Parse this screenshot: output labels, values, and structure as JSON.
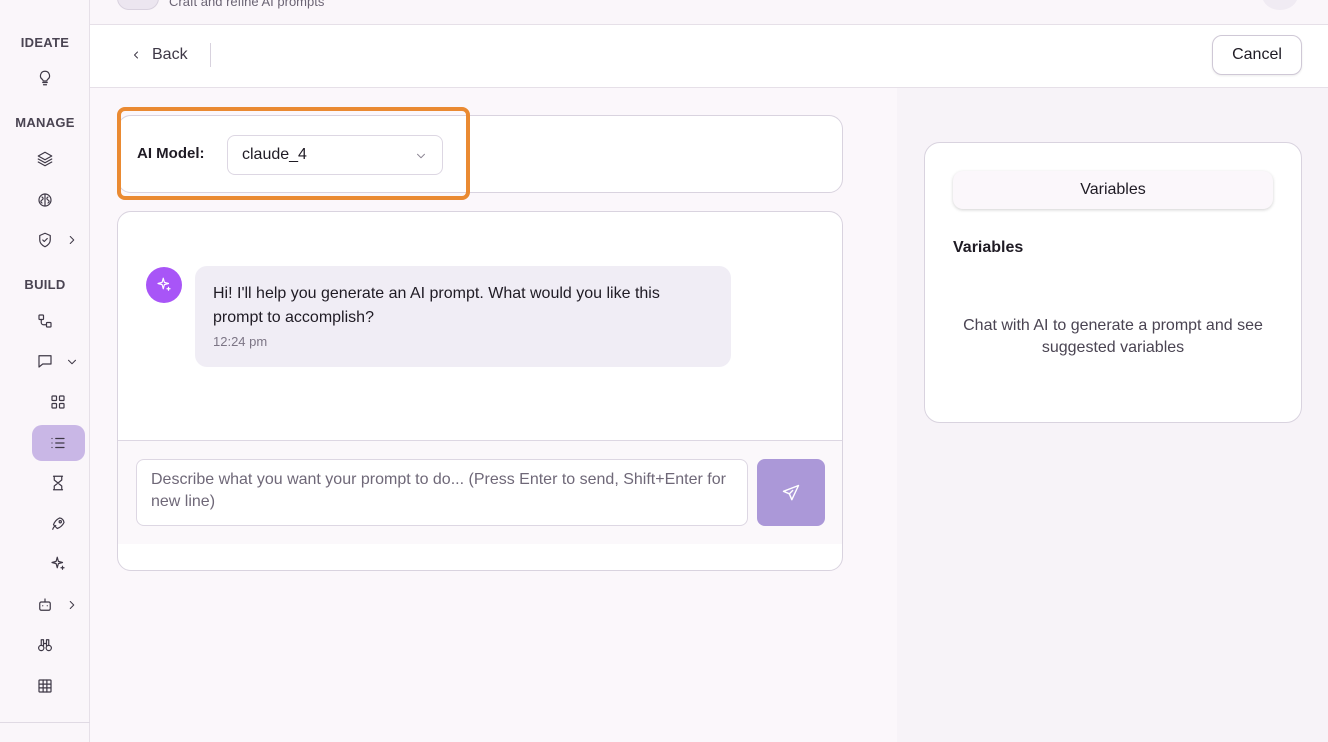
{
  "topbar": {
    "subtitle": "Craft and refine AI prompts"
  },
  "sidebar": {
    "sections": {
      "ideate": "IDEATE",
      "manage": "MANAGE",
      "build": "BUILD"
    }
  },
  "header": {
    "back_label": "Back",
    "cancel_label": "Cancel"
  },
  "model": {
    "label": "AI Model:",
    "selected": "claude_4"
  },
  "chat": {
    "message": "Hi! I'll help you generate an AI prompt. What would you like this prompt to accomplish?",
    "time": "12:24 pm",
    "input_placeholder": "Describe what you want your prompt to do... (Press Enter to send, Shift+Enter for new line)"
  },
  "variables": {
    "tab_label": "Variables",
    "heading": "Variables",
    "empty_text": "Chat with AI to generate a prompt and see suggested variables"
  },
  "colors": {
    "accent": "#a855f7",
    "highlight": "#ea8a32",
    "send_button": "#ab98d8",
    "active_nav": "#c9b7e6"
  }
}
